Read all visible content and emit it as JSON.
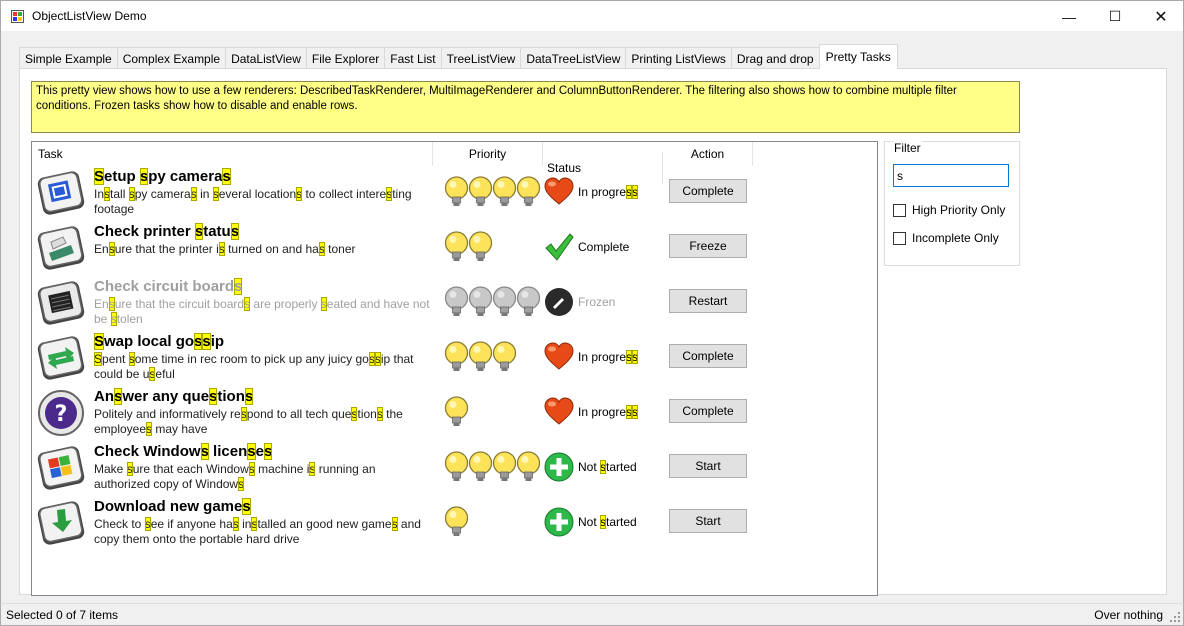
{
  "window": {
    "title": "ObjectListView Demo"
  },
  "tabs": [
    {
      "label": "Simple Example"
    },
    {
      "label": "Complex Example"
    },
    {
      "label": "DataListView"
    },
    {
      "label": "File Explorer"
    },
    {
      "label": "Fast List"
    },
    {
      "label": "TreeListView"
    },
    {
      "label": "DataTreeListView"
    },
    {
      "label": "Printing ListViews"
    },
    {
      "label": "Drag and drop"
    },
    {
      "label": "Pretty Tasks"
    }
  ],
  "active_tab": "Pretty Tasks",
  "info_text": "This pretty view shows how to use a few renderers: DescribedTaskRenderer, MultiImageRenderer and ColumnButtonRenderer. The filtering also shows how to combine multiple filter conditions. Frozen tasks show how to disable and enable rows.",
  "columns": {
    "task": "Task",
    "priority": "Priority",
    "status": "Status",
    "action": "Action"
  },
  "tasks": [
    {
      "title": "Setup spy cameras",
      "desc": "Install spy cameras in several locations to collect interesting footage",
      "priority": 4,
      "status": "In progress",
      "action": "Complete",
      "icon": "camera-icon"
    },
    {
      "title": "Check printer status",
      "desc": "Ensure that the printer is turned on and has toner",
      "priority": 2,
      "status": "Complete",
      "action": "Freeze",
      "icon": "printer-icon"
    },
    {
      "title": "Check circuit boards",
      "desc": "Ensure that the circuit boards are properly seated and have not be stolen",
      "priority": 4,
      "status": "Frozen",
      "action": "Restart",
      "icon": "circuit-board-icon",
      "frozen": true
    },
    {
      "title": "Swap local gossip",
      "desc": "Spent some time in rec room to pick up any juicy gossip that could be useful",
      "priority": 3,
      "status": "In progress",
      "action": "Complete",
      "icon": "swap-arrows-icon"
    },
    {
      "title": "Answer any questions",
      "desc": "Politely and informatively respond to all tech questions the employees may have",
      "priority": 1,
      "status": "In progress",
      "action": "Complete",
      "icon": "question-icon"
    },
    {
      "title": "Check Windows licenses",
      "desc": "Make sure that each Windows machine is running an authorized copy of Windows",
      "priority": 4,
      "status": "Not started",
      "action": "Start",
      "icon": "windows-logo-icon"
    },
    {
      "title": "Download new games",
      "desc": "Check to see if anyone has installed an good new games and copy them onto the portable hard drive",
      "priority": 1,
      "status": "Not started",
      "action": "Start",
      "icon": "download-icon"
    }
  ],
  "filter": {
    "legend": "Filter",
    "value": "s",
    "high_priority_label": "High Priority Only",
    "incomplete_label": "Incomplete Only",
    "high_priority_checked": false,
    "incomplete_checked": false
  },
  "statusbar": {
    "left": "Selected 0 of 7 items",
    "right": "Over nothing"
  },
  "colors": {
    "highlight": "#ffff00",
    "info_bg": "#ffff88",
    "active_blue": "#0078d7"
  }
}
